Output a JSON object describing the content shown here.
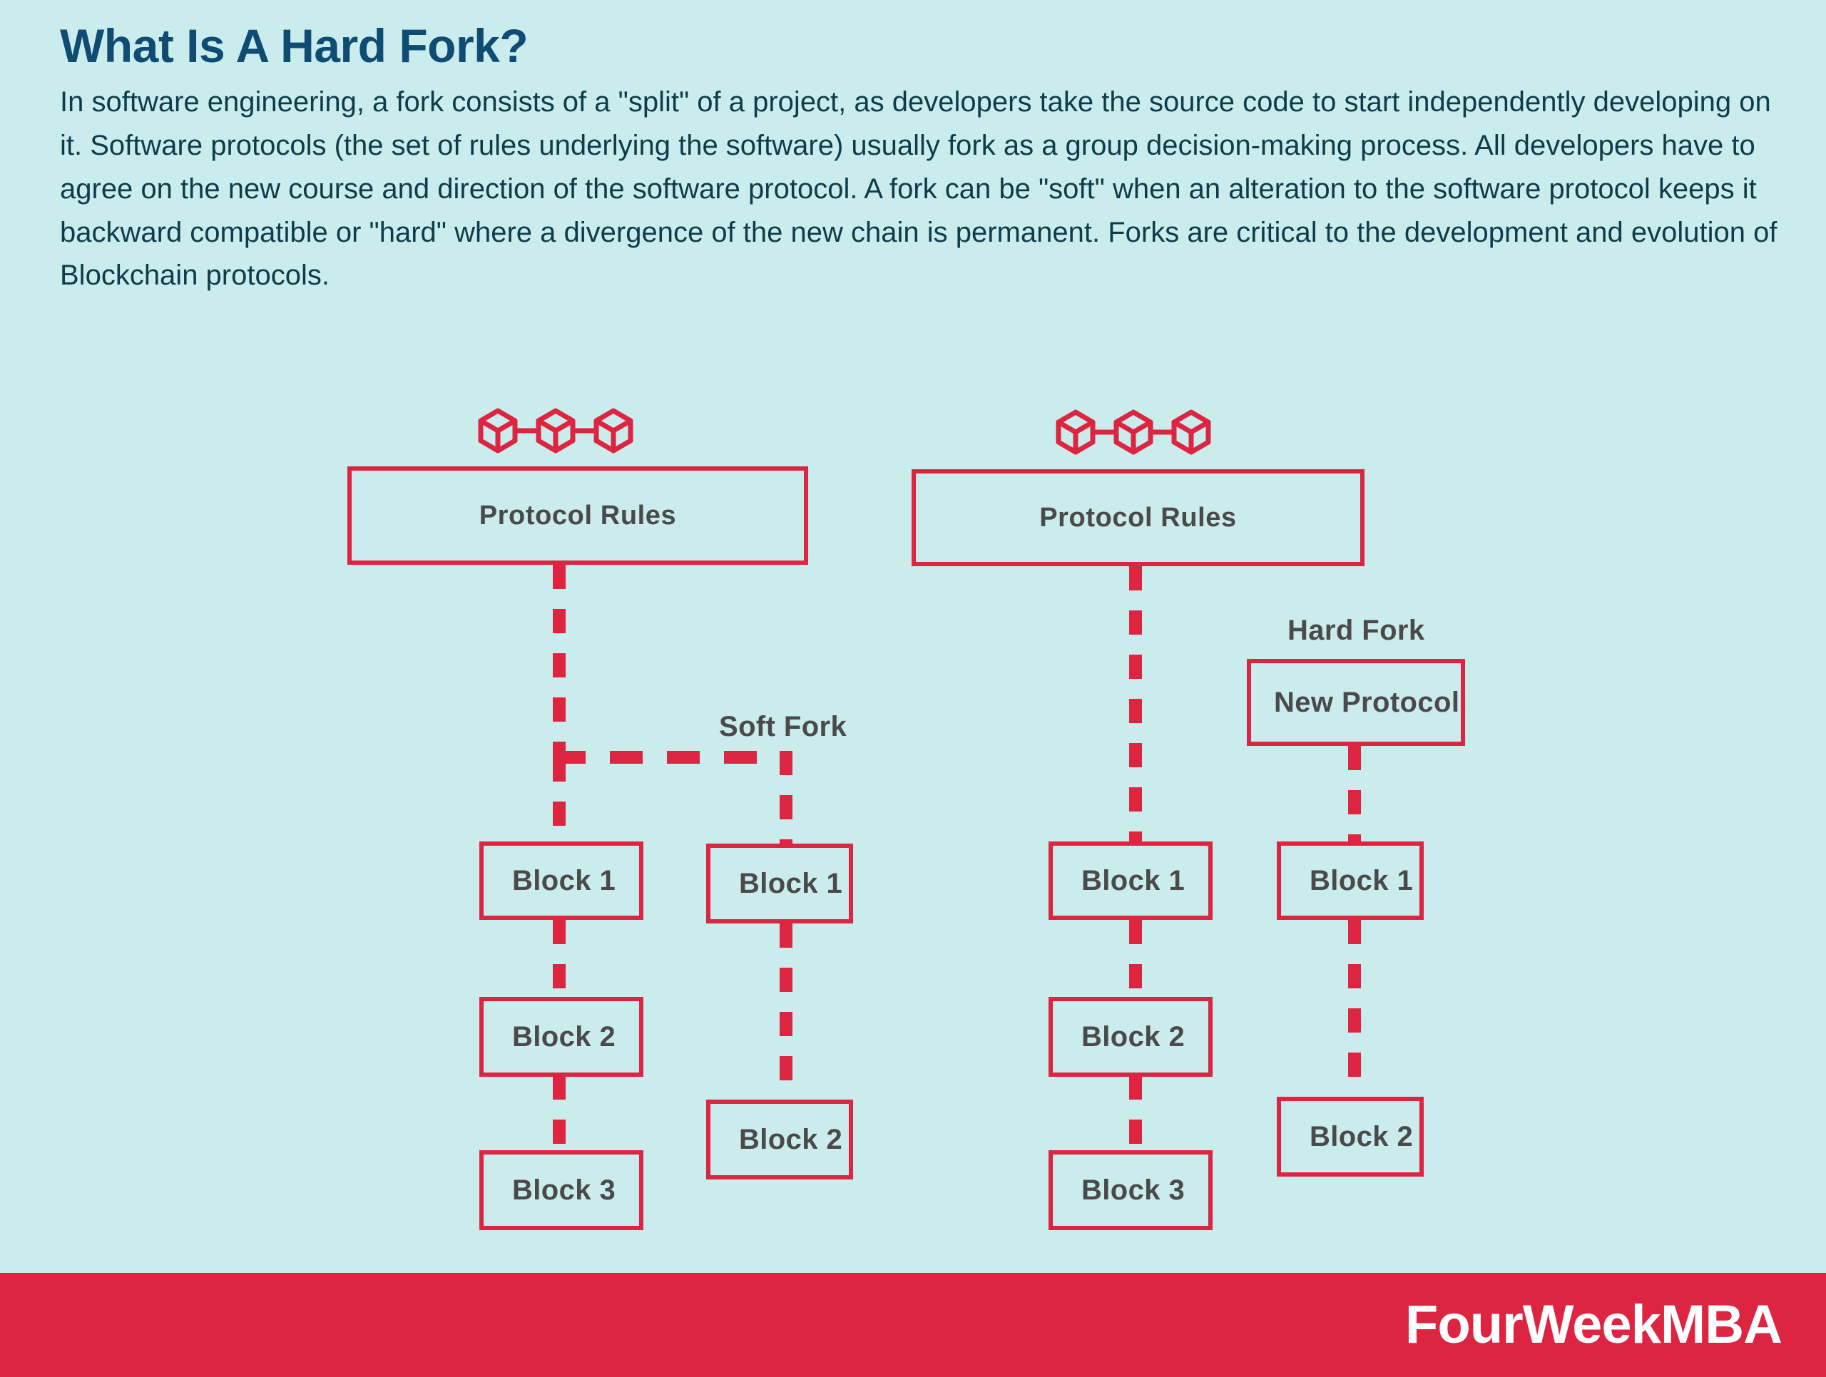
{
  "header": {
    "title": "What Is A Hard Fork?",
    "body": "In software engineering, a fork consists of a \"split\" of a project, as developers take the source code to start independently developing on it. Software protocols (the set of rules underlying the software) usually fork as a group decision-making process. All developers have to agree on the new course and direction of the software protocol. A fork can be \"soft\" when an alteration to the software protocol keeps it backward compatible or \"hard\" where a divergence of the new chain is permanent. Forks are critical to the development and evolution of Blockchain protocols."
  },
  "colors": {
    "background": "#cbeced",
    "accent_red": "#dd2440",
    "title_blue": "#0f4c73",
    "body_teal": "#0d3d4a",
    "label_gray": "#4a4a4a",
    "banner_text": "#ffffff"
  },
  "icons": {
    "blockchain": "blockchain-cubes-icon"
  },
  "soft_fork_diagram": {
    "protocol_box": "Protocol Rules",
    "fork_label": "Soft Fork",
    "main_chain": [
      "Block 1",
      "Block 2",
      "Block 3"
    ],
    "fork_chain": [
      "Block 1",
      "Block 2"
    ]
  },
  "hard_fork_diagram": {
    "protocol_box": "Protocol Rules",
    "fork_label": "Hard Fork",
    "new_protocol_box": "New Protocol",
    "main_chain": [
      "Block 1",
      "Block 2",
      "Block 3"
    ],
    "fork_chain": [
      "Block 1",
      "Block 2"
    ]
  },
  "footer": {
    "brand": "FourWeekMBA"
  }
}
